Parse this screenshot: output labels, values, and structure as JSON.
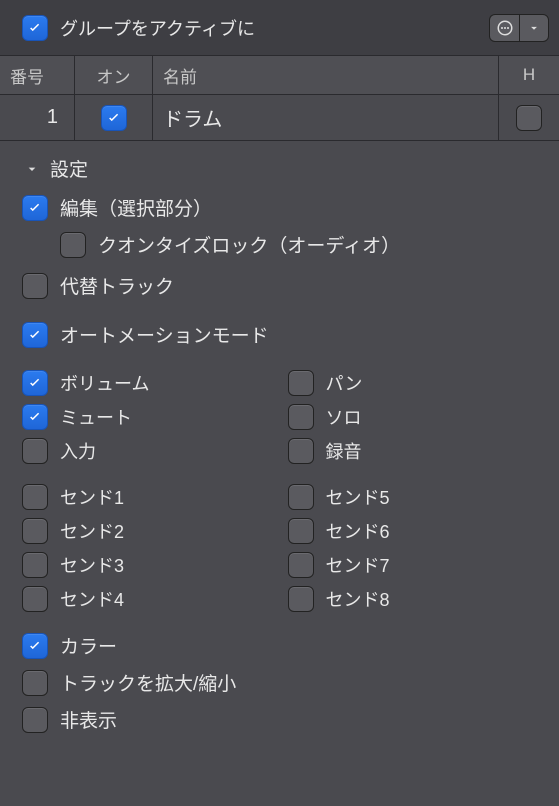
{
  "topbar": {
    "activate_label": "グループをアクティブに",
    "activate_checked": true
  },
  "columns": {
    "num": "番号",
    "on": "オン",
    "name": "名前",
    "h": "H"
  },
  "rows": [
    {
      "num": "1",
      "on": true,
      "name": "ドラム",
      "h": false
    }
  ],
  "settings": {
    "title": "設定",
    "edit_selection": {
      "label": "編集（選択部分）",
      "checked": true
    },
    "quantize_lock": {
      "label": "クオンタイズロック（オーディオ）",
      "checked": false
    },
    "alt_track": {
      "label": "代替トラック",
      "checked": false
    },
    "automation_mode": {
      "label": "オートメーションモード",
      "checked": true
    },
    "volume": {
      "label": "ボリューム",
      "checked": true
    },
    "pan": {
      "label": "パン",
      "checked": false
    },
    "mute": {
      "label": "ミュート",
      "checked": true
    },
    "solo": {
      "label": "ソロ",
      "checked": false
    },
    "input": {
      "label": "入力",
      "checked": false
    },
    "record": {
      "label": "録音",
      "checked": false
    },
    "send1": {
      "label": "センド1",
      "checked": false
    },
    "send2": {
      "label": "センド2",
      "checked": false
    },
    "send3": {
      "label": "センド3",
      "checked": false
    },
    "send4": {
      "label": "センド4",
      "checked": false
    },
    "send5": {
      "label": "センド5",
      "checked": false
    },
    "send6": {
      "label": "センド6",
      "checked": false
    },
    "send7": {
      "label": "センド7",
      "checked": false
    },
    "send8": {
      "label": "センド8",
      "checked": false
    },
    "color": {
      "label": "カラー",
      "checked": true
    },
    "zoom": {
      "label": "トラックを拡大/縮小",
      "checked": false
    },
    "hide": {
      "label": "非表示",
      "checked": false
    }
  }
}
